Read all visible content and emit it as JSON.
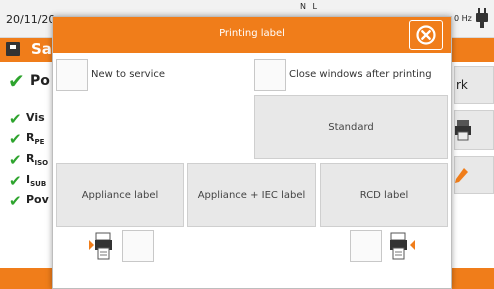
{
  "background": {
    "date": "20/11/20",
    "nl_indicator": "N L",
    "hz_indicator": "0 Hz",
    "title": "Sa",
    "result": "Po",
    "items": [
      "Vis",
      "R",
      "R",
      "I",
      "Pov"
    ],
    "item_subscripts": [
      "",
      "PE",
      "ISO",
      "SUB",
      ""
    ],
    "right_button_text": "rk",
    "accent": "#f07d1a",
    "check_color": "#2ea42e"
  },
  "dialog": {
    "title": "Printing label",
    "close_icon": "close-circle-icon",
    "options": {
      "new_to_service": "New to service",
      "close_after_printing": "Close windows after printing"
    },
    "buttons": {
      "standard": "Standard",
      "appliance_label": "Appliance label",
      "appliance_iec_label": "Appliance + IEC label",
      "rcd_label": "RCD label"
    },
    "icons": {
      "left_printer": "printer-left-icon",
      "right_printer": "printer-right-icon"
    }
  }
}
